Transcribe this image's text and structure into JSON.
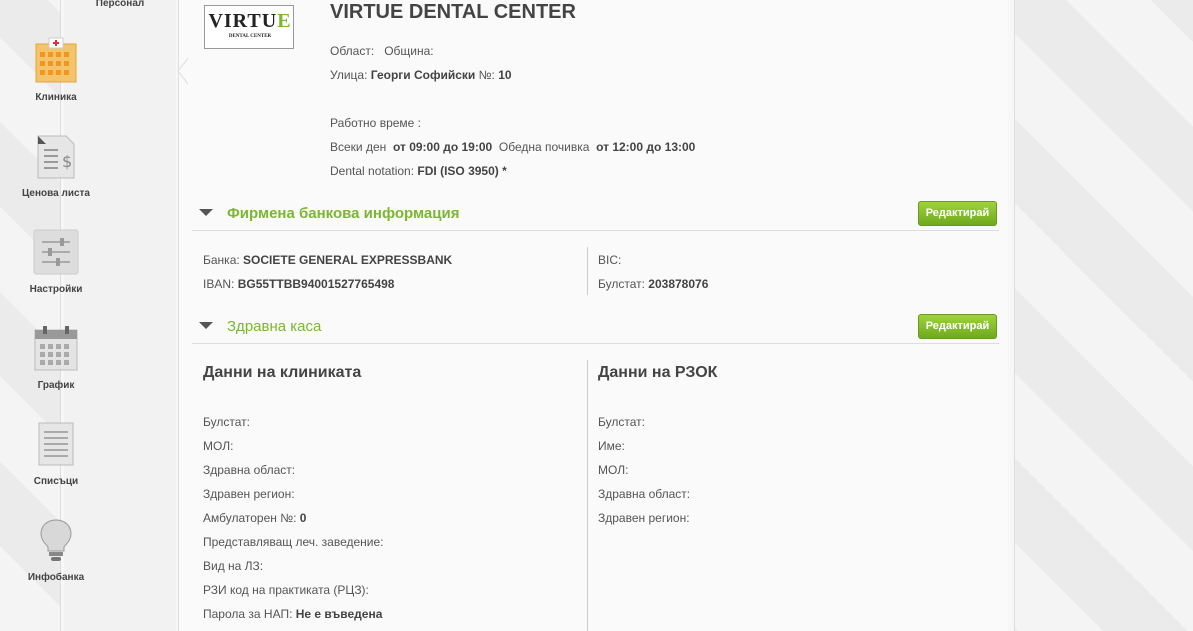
{
  "sidebar": {
    "top_label": "Персонал",
    "items": [
      {
        "label": "Клиника",
        "icon": "hospital-icon"
      },
      {
        "label": "Ценова листа",
        "icon": "price-list-icon"
      },
      {
        "label": "Настройки",
        "icon": "settings-icon"
      },
      {
        "label": "График",
        "icon": "calendar-icon"
      },
      {
        "label": "Списъци",
        "icon": "list-icon"
      },
      {
        "label": "Инфобанка",
        "icon": "lightbulb-icon"
      }
    ]
  },
  "logo": {
    "text_main": "VIRTU",
    "text_accent": "E",
    "text_sub": "DENTAL CENTER"
  },
  "clinic": {
    "name": "VIRTUE DENTAL CENTER",
    "region_label": "Област:",
    "municipality_label": "Община:",
    "street_label": "Улица:",
    "street_value": "Георги Софийски",
    "number_label": "№:",
    "number_value": "10",
    "hours_label": "Работно време :",
    "every_day_label": "Всеки ден",
    "every_day_value": "от 09:00 до 19:00",
    "lunch_label": "Обедна почивка",
    "lunch_value": "от 12:00 до 13:00",
    "notation_label": "Dental notation:",
    "notation_value": "FDI (ISO 3950) *"
  },
  "bank_section": {
    "title": "Фирмена банкова информация",
    "edit_label": "Редактирай",
    "bank_label": "Банка:",
    "bank_value": "SOCIETE GENERAL EXPRESSBANK",
    "iban_label": "IBAN:",
    "iban_value": "BG55TTBB94001527765498",
    "bic_label": "BIC:",
    "bulstat_label": "Булстат:",
    "bulstat_value": "203878076"
  },
  "health_section": {
    "title": "Здравна каса",
    "edit_label": "Редактирай",
    "clinic_col_title": "Данни на клиниката",
    "clinic_fields": [
      {
        "label": "Булстат:",
        "value": ""
      },
      {
        "label": "МОЛ:",
        "value": ""
      },
      {
        "label": "Здравна област:",
        "value": ""
      },
      {
        "label": "Здравен регион:",
        "value": ""
      },
      {
        "label": "Амбулаторен №:",
        "value": "0"
      },
      {
        "label": "Представляващ леч. заведение:",
        "value": ""
      },
      {
        "label": "Вид на ЛЗ:",
        "value": ""
      },
      {
        "label": "РЗИ код на практиката (РЦЗ):",
        "value": ""
      },
      {
        "label": "Парола за НАП:",
        "value": "Не е въведена"
      }
    ],
    "rzok_col_title": "Данни на РЗОК",
    "rzok_fields": [
      {
        "label": "Булстат:",
        "value": ""
      },
      {
        "label": "Име:",
        "value": ""
      },
      {
        "label": "МОЛ:",
        "value": ""
      },
      {
        "label": "Здравна област:",
        "value": ""
      },
      {
        "label": "Здравен регион:",
        "value": ""
      }
    ]
  },
  "colors": {
    "accent": "#7cb82f",
    "button": "#8bc34a"
  }
}
